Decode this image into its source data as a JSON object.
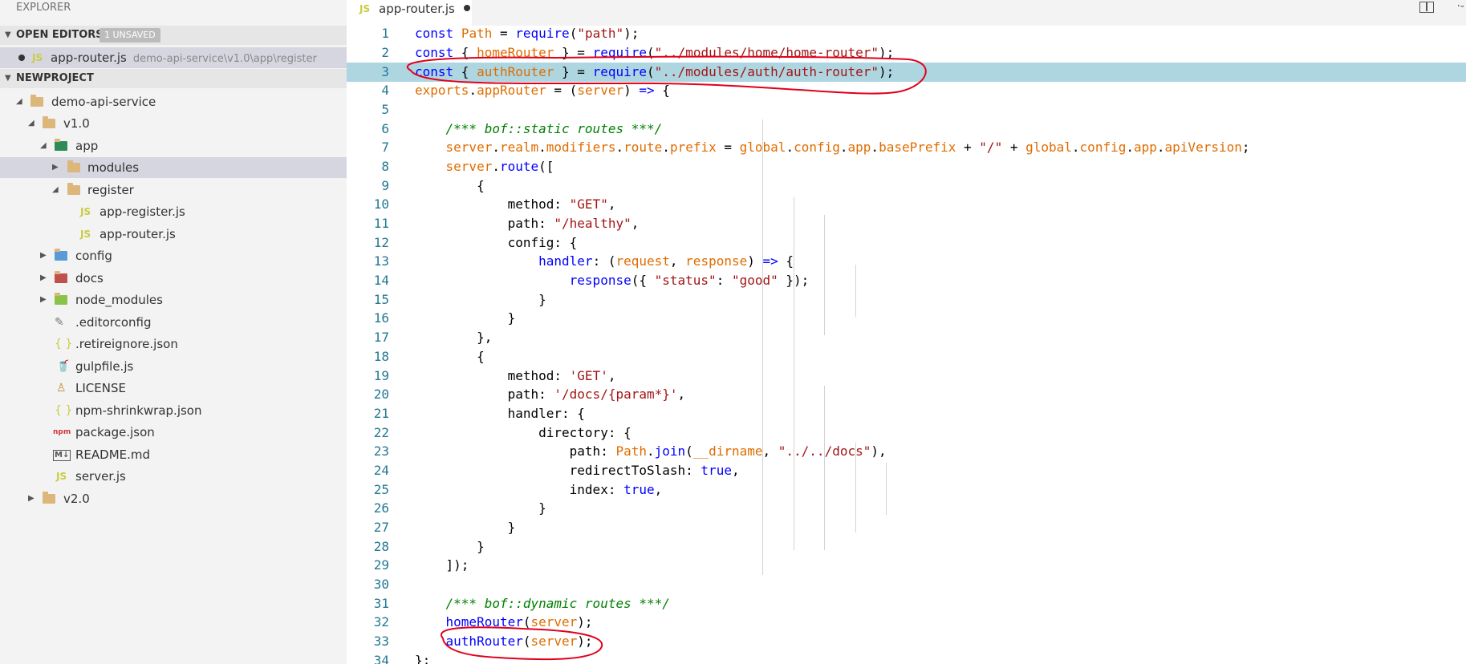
{
  "sidebar": {
    "title": "EXPLORER",
    "open_editors": {
      "label": "OPEN EDITORS",
      "badge": "1 UNSAVED",
      "items": [
        {
          "name": "app-router.js",
          "path": "demo-api-service\\v1.0\\app\\register"
        }
      ]
    },
    "project": {
      "label": "NEWPROJECT",
      "tree": [
        "demo-api-service",
        "v1.0",
        "app",
        "modules",
        "register",
        "app-register.js",
        "app-router.js",
        "config",
        "docs",
        "node_modules",
        ".editorconfig",
        ".retireignore.json",
        "gulpfile.js",
        "LICENSE",
        "npm-shrinkwrap.json",
        "package.json",
        "README.md",
        "server.js",
        "v2.0"
      ]
    }
  },
  "editor": {
    "tab_label": "app-router.js",
    "line_numbers": [
      "1",
      "2",
      "3",
      "4",
      "5",
      "6",
      "7",
      "8",
      "9",
      "10",
      "11",
      "12",
      "13",
      "14",
      "15",
      "16",
      "17",
      "18",
      "19",
      "20",
      "21",
      "22",
      "23",
      "24",
      "25",
      "26",
      "27",
      "28",
      "29",
      "30",
      "31",
      "32",
      "33",
      "34"
    ]
  },
  "colors": {
    "keyword": "#0000ff",
    "string": "#a31515",
    "variable": "#e06c00",
    "comment": "#008000",
    "highlight": "#add6e1",
    "annotation": "#e0001a"
  }
}
